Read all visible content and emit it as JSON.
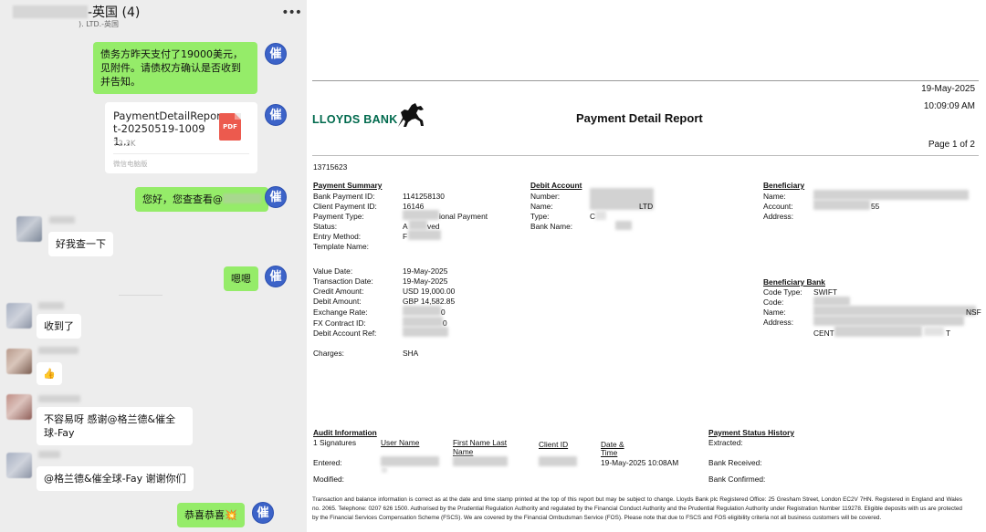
{
  "chat": {
    "title_suffix": "-英国 (4)",
    "subtitle": "). LTD.-英国",
    "more_icon": "more-icon",
    "me_avatar_char": "催",
    "messages": {
      "m1_text": "债务方昨天支付了19000美元，见附件。请债权方确认是否收到并告知。",
      "file_name": "PaymentDetailReport-20250519-10091...",
      "file_size": "72.3K",
      "file_source": "微信电脑版",
      "file_icon": "PDF",
      "m3_text": "您好，您查查看@",
      "m4_text": "好我查一下",
      "m5_text": "嗯嗯",
      "m6_text": "收到了",
      "m7_text": "👍",
      "m8_text": "不容易呀 感谢@格兰德&催全球-Fay",
      "m9_text": "@格兰德&催全球-Fay 谢谢你们",
      "m10_text": "恭喜恭喜💥"
    }
  },
  "report": {
    "date": "19-May-2025",
    "time": "10:09:09 AM",
    "logo": "LLOYDS BANK",
    "title": "Payment Detail Report",
    "page": "Page 1 of 2",
    "ref_number": "13715623",
    "payment_summary": {
      "heading": "Payment Summary",
      "labels": [
        "Bank Payment ID:",
        "Client Payment ID:",
        "Payment Type:",
        "Status:",
        "Entry Method:",
        "Template Name:"
      ],
      "bank_payment_id": "1141258130",
      "client_payment_id": "16146",
      "payment_type": "ional Payment",
      "status_value": "A",
      "status_value2": "ved",
      "entry_method": "F",
      "labels2": [
        "Value Date:",
        "Transaction Date:",
        "Credit Amount:",
        "Debit Amount:",
        "Exchange Rate:",
        "FX Contract ID:",
        "Debit Account Ref:"
      ],
      "value_date": "19-May-2025",
      "transaction_date": "19-May-2025",
      "credit_amount": "USD  19,000.00",
      "debit_amount": "GBP  14,582.85",
      "exchange_rate_tail": "0",
      "fx_tail": "0",
      "charges_label": "Charges:",
      "charges_value": "SHA"
    },
    "debit_account": {
      "heading": "Debit Account",
      "labels": [
        "Number:",
        "Name:",
        "Type:",
        "Bank Name:"
      ],
      "name_tail": "LTD",
      "type_value": "C"
    },
    "beneficiary": {
      "heading": "Beneficiary",
      "labels": [
        "Name:",
        "Account:",
        "Address:"
      ],
      "account_tail": "55"
    },
    "beneficiary_bank": {
      "heading": "Beneficiary Bank",
      "labels": [
        "Code Type:",
        "Code:",
        "Name:",
        "Address:"
      ],
      "code_type": "SWIFT",
      "name_tail": "NSF",
      "addr_part1": "CENT",
      "addr_part2": "T"
    },
    "audit": {
      "heading": "Audit Information",
      "signatures": "1 Signatures",
      "col_user": "User Name",
      "col_first_last_1": "First Name Last",
      "col_first_last_2": "Name",
      "col_client": "Client ID",
      "col_date_1": "Date &",
      "col_date_2": "Time",
      "entered_label": "Entered:",
      "entered_datetime": "19-May-2025  10:08AM",
      "modified_label": "Modified:"
    },
    "status_history": {
      "heading": "Payment Status History",
      "labels": [
        "Extracted:",
        "Bank Received:",
        "Bank Confirmed:"
      ]
    },
    "footer": "Transaction and balance information is correct as at the date and time stamp printed at the top of this report but may be subject to change. Lloyds Bank plc Registered Office: 25 Gresham Street, London EC2V 7HN. Registered in England and Wales no. 2065. Telephone: 0207 626 1500. Authorised by the Prudential Regulation Authority and regulated by the Financial Conduct Authority and the Prudential Regulation Authority under Registration Number 119278. Eligible deposits with us are protected by the Financial Services Compensation Scheme (FSCS). We are covered by the Financial Ombudsman Service (FOS). Please note that due to FSCS and FOS eligibility criteria not all business customers will be covered."
  }
}
